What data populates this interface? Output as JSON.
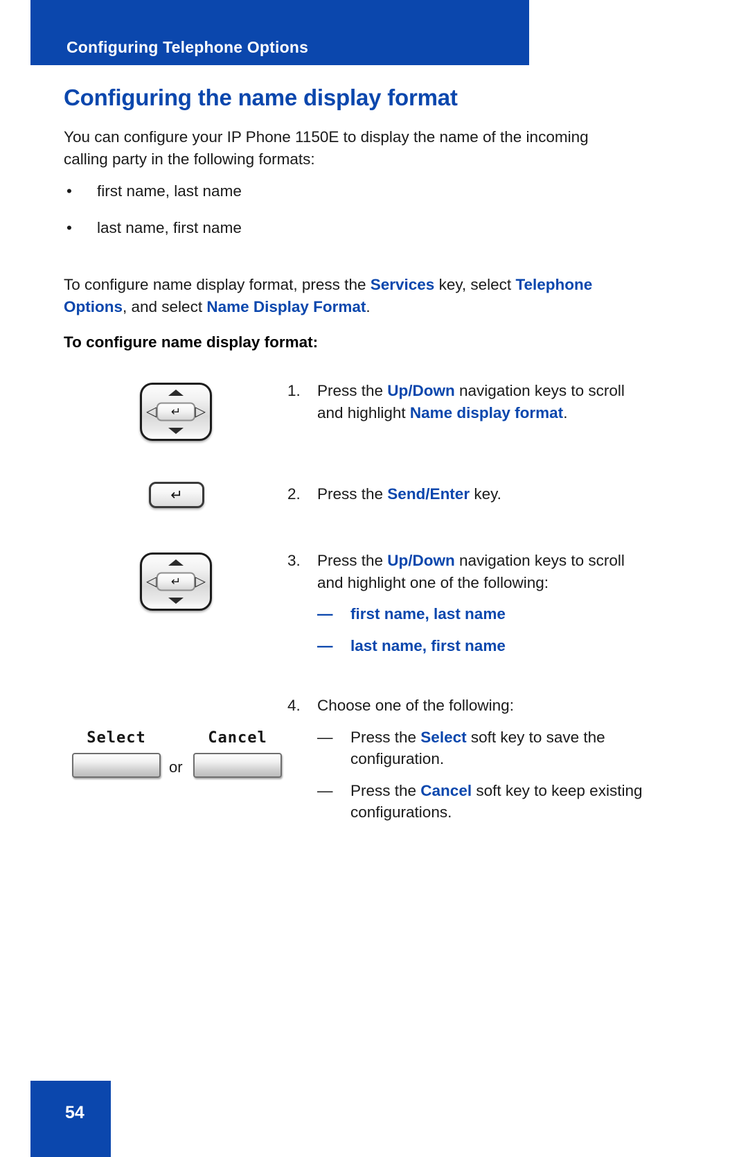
{
  "header": {
    "running_title": "Configuring Telephone Options"
  },
  "page": {
    "heading": "Configuring the name display format",
    "intro_paragraph": "You can configure your IP Phone 1150E to display the name of the incoming calling party in the following formats:",
    "format_bullets": [
      "first name, last name",
      "last name, first name"
    ],
    "bullet_marker": "•",
    "nav_paragraph": {
      "part1": "To configure name display format, press the ",
      "key1": "Services",
      "part2": " key, select ",
      "key2": "Telephone Options",
      "part3": ", and select ",
      "key3": "Name Display Format",
      "part4": "."
    },
    "procedure_heading": "To configure name display format:"
  },
  "steps": [
    {
      "number": "1.",
      "text_part1": "Press the ",
      "key1": "Up/Down",
      "text_part2": " navigation keys to scroll and highlight ",
      "key2": "Name display format",
      "text_part3": "."
    },
    {
      "number": "2.",
      "text_part1": "Press the ",
      "key1": "Send/Enter",
      "text_part2": " key.",
      "text_part3": ""
    },
    {
      "number": "3.",
      "text_part1": "Press the ",
      "key1": "Up/Down",
      "text_part2": " navigation keys to scroll and highlight one of the following:",
      "text_part3": "",
      "sub_items": [
        "first name, last name",
        "last name, first name"
      ]
    },
    {
      "number": "4.",
      "text_part1": "Choose one of the following:",
      "key1": "",
      "text_part2": "",
      "text_part3": "",
      "sub_items_rich": [
        {
          "pre": "Press the ",
          "key": "Select",
          "post": " soft key to save the configuration."
        },
        {
          "pre": "Press the ",
          "key": "Cancel",
          "post": " soft key to keep existing configurations."
        }
      ]
    }
  ],
  "icons": {
    "nav_cluster_enter_glyph": "↵",
    "nav_cluster_left_glyph": "◁",
    "nav_cluster_right_glyph": "▷",
    "enter_key_glyph": "↵",
    "dash_marker": "—"
  },
  "softkeys": {
    "select_label": "Select",
    "cancel_label": "Cancel",
    "or_label": "or"
  },
  "footer": {
    "page_number": "54"
  },
  "colors": {
    "brand_blue": "#0b47ad",
    "text_black": "#1a1a1a",
    "page_background": "#ffffff"
  }
}
